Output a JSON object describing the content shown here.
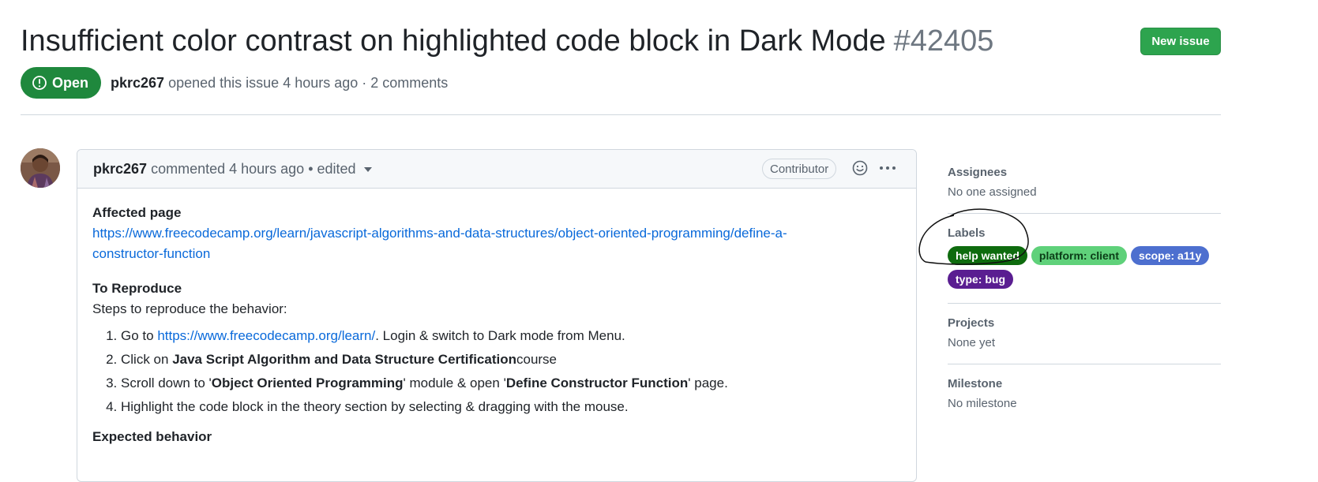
{
  "issue": {
    "title": "Insufficient color contrast on highlighted code block in Dark Mode",
    "number": "#42405",
    "new_issue_label": "New issue",
    "state_label": "Open",
    "author": "pkrc267",
    "meta_text": "opened this issue 4 hours ago · 2 comments"
  },
  "comment": {
    "author": "pkrc267",
    "meta": "commented 4 hours ago • edited",
    "role_badge": "Contributor",
    "icons": {
      "reaction": "smiley-icon",
      "menu": "kebab-icon",
      "dropdown": "chevron-down-icon"
    },
    "body": {
      "affected_heading": "Affected page",
      "affected_link_line1": "https://www.freecodecamp.org/learn/javascript-algorithms-and-data-structures/object-oriented-programming/define-a-",
      "affected_link_line2": "constructor-function",
      "reproduce_heading": "To Reproduce",
      "steps_intro": "Steps to reproduce the behavior:",
      "step1_pre": "Go to ",
      "step1_link": "https://www.freecodecamp.org/learn/",
      "step1_post": ". Login & switch to Dark mode from Menu.",
      "step2_pre": "Click on ",
      "step2_bold": "Java Script Algorithm and Data Structure Certification",
      "step2_post": "course",
      "step3_a": "Scroll down to '",
      "step3_bold1": "Object Oriented Programming",
      "step3_b": "' module & open '",
      "step3_bold2": "Define Constructor Function",
      "step3_c": "' page.",
      "step4": "Highlight the code block in the theory section by selecting & dragging with the mouse.",
      "expected_heading": "Expected behavior"
    }
  },
  "sidebar": {
    "assignees_heading": "Assignees",
    "assignees_value": "No one assigned",
    "labels_heading": "Labels",
    "labels": [
      {
        "text": "help wanted",
        "bg": "#0e6b0e",
        "fg": "#ffffff"
      },
      {
        "text": "platform: client",
        "bg": "#5fd17a",
        "fg": "#0b3d17"
      },
      {
        "text": "scope: a11y",
        "bg": "#4d6fcf",
        "fg": "#ffffff"
      },
      {
        "text": "type: bug",
        "bg": "#5a1e91",
        "fg": "#ffffff"
      }
    ],
    "projects_heading": "Projects",
    "projects_value": "None yet",
    "milestone_heading": "Milestone",
    "milestone_value": "No milestone"
  },
  "colors": {
    "open_green": "#1f883d",
    "button_green": "#2da44e",
    "link_blue": "#0969da",
    "muted_text": "#59636e",
    "border": "#d0d7de"
  }
}
